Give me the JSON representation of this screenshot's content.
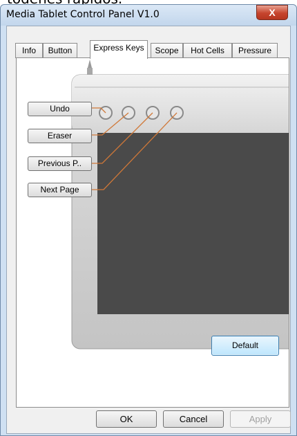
{
  "background_caption": "todenes rapidos.",
  "window": {
    "title": "Media Tablet Control Panel V1.0",
    "close_glyph": "X"
  },
  "tabs": [
    {
      "label": "Info",
      "active": false
    },
    {
      "label": "Button",
      "active": false
    },
    {
      "label": "Express Keys",
      "active": true
    },
    {
      "label": "Scope",
      "active": false
    },
    {
      "label": "Hot Cells",
      "active": false
    },
    {
      "label": "Pressure",
      "active": false
    }
  ],
  "express_keys": [
    {
      "label": "Undo"
    },
    {
      "label": "Eraser"
    },
    {
      "label": "Previous P.."
    },
    {
      "label": "Next Page"
    }
  ],
  "default_button": "Default",
  "dialog_buttons": {
    "ok": "OK",
    "cancel": "Cancel",
    "apply": "Apply",
    "apply_enabled": false
  },
  "colors": {
    "titlebar": "#c2d6ec",
    "close": "#c6452e",
    "tablet_surface": "#4a4a4a",
    "leader_line": "#d07838"
  }
}
